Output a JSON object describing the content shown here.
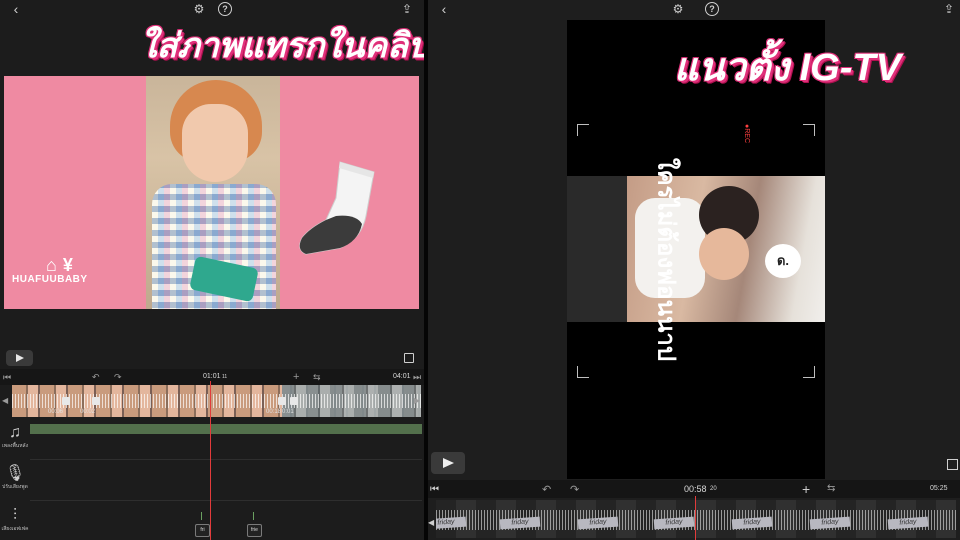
{
  "left_panel": {
    "headline": "ใส่ภาพแทรกในคลิป",
    "brand": "HUAFUUBABY",
    "timeline": {
      "current_time": "01:01",
      "current_frame": "11",
      "end_time": "04:01",
      "clip_labels": [
        "00:06",
        "00:02",
        "00:18",
        "0:01"
      ],
      "tracks": [
        {
          "label": "เพลงพื้นหลัง",
          "icon": "music-note-icon"
        },
        {
          "label": "ปรับเสียงพูด",
          "icon": "microphone-icon"
        },
        {
          "label": "เสียงเอฟเฟค",
          "icon": "waveform-icon"
        }
      ],
      "markers": [
        "fri",
        "frie"
      ]
    }
  },
  "right_panel": {
    "headline": "แนวตั้ง IG-TV",
    "overlay_text": "ใครไม่ต้องฟอนนาป",
    "bubble_text": "ด.",
    "rec_label": "●REC",
    "timeline": {
      "current_time": "00:58",
      "current_frame": "20",
      "end_time": "05:25",
      "sticker_label": "friday"
    }
  },
  "colors": {
    "accent_pink": "#e0307a",
    "preview_bg_pink": "#ef8aa2",
    "playhead": "#e23b3b",
    "music_track": "#53704c"
  }
}
